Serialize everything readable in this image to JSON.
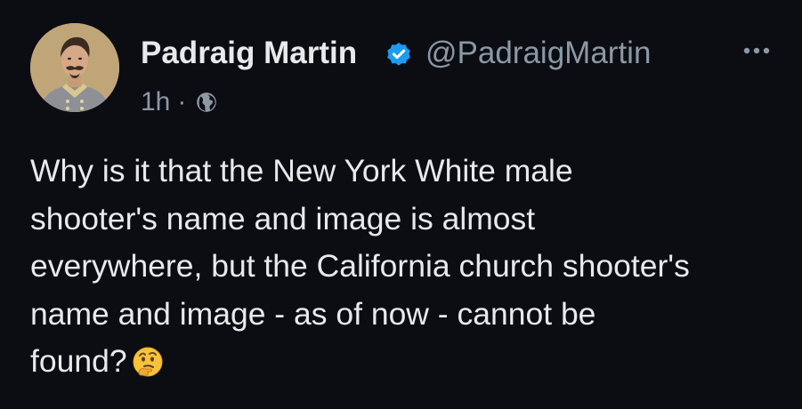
{
  "tweet": {
    "author": {
      "display_name": "Padraig Martin",
      "handle": "@PadraigMartin",
      "avatar_icon": "portrait-avatar",
      "verified_icon": "verified-badge-icon"
    },
    "timestamp": "1h",
    "separator": "·",
    "visibility_icon": "globe-icon",
    "more_icon": "more-options-icon",
    "text": "Why is it that the New York White male\nshooter's name and image is almost\neverywhere, but the California church shooter's\nname and image - as of now - cannot be\nfound?",
    "trailing_emoji": "thinking-face-emoji"
  },
  "colors": {
    "background": "#0b0d12",
    "primary_text": "#e7e9ea",
    "secondary_text": "#8b98a5",
    "verified_blue": "#1d9bf0"
  }
}
